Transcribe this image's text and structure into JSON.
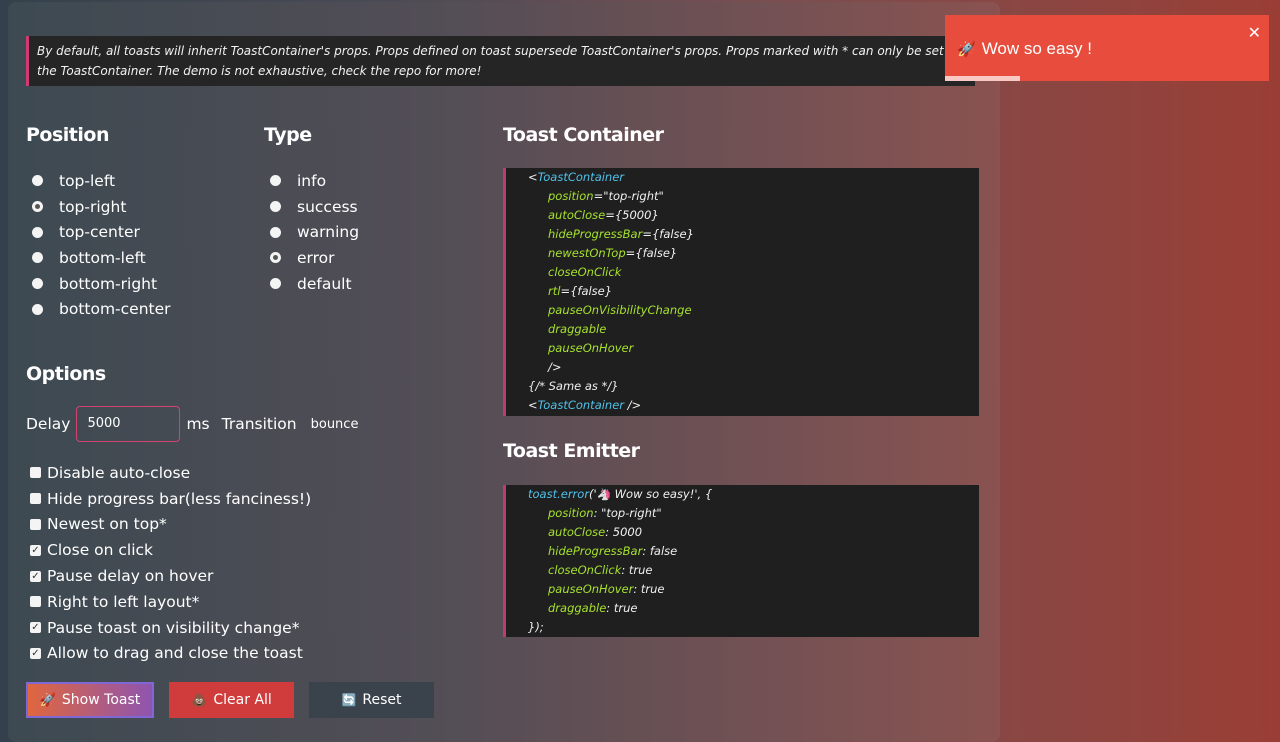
{
  "intro": "By default, all toasts will inherit ToastContainer's props. Props defined on toast supersede ToastContainer's props. Props marked with * can only be set on the ToastContainer. The demo is not exhaustive, check the repo for more!",
  "position": {
    "title": "Position",
    "options": [
      {
        "label": "top-left",
        "checked": false
      },
      {
        "label": "top-right",
        "checked": true
      },
      {
        "label": "top-center",
        "checked": false
      },
      {
        "label": "bottom-left",
        "checked": false
      },
      {
        "label": "bottom-right",
        "checked": false
      },
      {
        "label": "bottom-center",
        "checked": false
      }
    ]
  },
  "type": {
    "title": "Type",
    "options": [
      {
        "label": "info",
        "checked": false
      },
      {
        "label": "success",
        "checked": false
      },
      {
        "label": "warning",
        "checked": false
      },
      {
        "label": "error",
        "checked": true
      },
      {
        "label": "default",
        "checked": false
      }
    ]
  },
  "options": {
    "title": "Options",
    "delay_label": "Delay",
    "delay_value": "5000",
    "ms_label": "ms",
    "transition_label": "Transition",
    "transition_value": "bounce",
    "checks": [
      {
        "label": "Disable auto-close",
        "checked": false
      },
      {
        "label": "Hide progress bar(less fanciness!)",
        "checked": false
      },
      {
        "label": "Newest on top*",
        "checked": false
      },
      {
        "label": "Close on click",
        "checked": true
      },
      {
        "label": "Pause delay on hover",
        "checked": true
      },
      {
        "label": "Right to left layout*",
        "checked": false
      },
      {
        "label": "Pause toast on visibility change*",
        "checked": true
      },
      {
        "label": "Allow to drag and close the toast",
        "checked": true
      }
    ]
  },
  "buttons": {
    "show": "Show Toast",
    "clear": "Clear All",
    "reset": "Reset"
  },
  "container_code": {
    "title": "Toast Container",
    "open_tag": "ToastContainer",
    "props": [
      {
        "name": "position",
        "value": "=\"top-right\""
      },
      {
        "name": "autoClose",
        "value": "={5000}"
      },
      {
        "name": "hideProgressBar",
        "value": "={false}"
      },
      {
        "name": "newestOnTop",
        "value": "={false}"
      },
      {
        "name": "closeOnClick",
        "value": ""
      },
      {
        "name": "rtl",
        "value": "={false}"
      },
      {
        "name": "pauseOnVisibilityChange",
        "value": ""
      },
      {
        "name": "draggable",
        "value": ""
      },
      {
        "name": "pauseOnHover",
        "value": ""
      }
    ],
    "close": "/>",
    "comment": "{/* Same as */}",
    "short_tag": "ToastContainer"
  },
  "emitter_code": {
    "title": "Toast Emitter",
    "call": "toast.error",
    "message": "('🦄 Wow so easy!', {",
    "props": [
      {
        "name": "position",
        "value": ": \"top-right\""
      },
      {
        "name": "autoClose",
        "value": ": 5000"
      },
      {
        "name": "hideProgressBar",
        "value": ": false"
      },
      {
        "name": "closeOnClick",
        "value": ": true"
      },
      {
        "name": "pauseOnHover",
        "value": ": true"
      },
      {
        "name": "draggable",
        "value": ": true"
      }
    ],
    "close": "});"
  },
  "toast": {
    "message": "Wow so easy !",
    "close": "✕",
    "progress": 0.23,
    "color": "#e74c3c"
  },
  "icons": {
    "rocket": "🚀",
    "poop": "💩",
    "reset": "🔄"
  }
}
